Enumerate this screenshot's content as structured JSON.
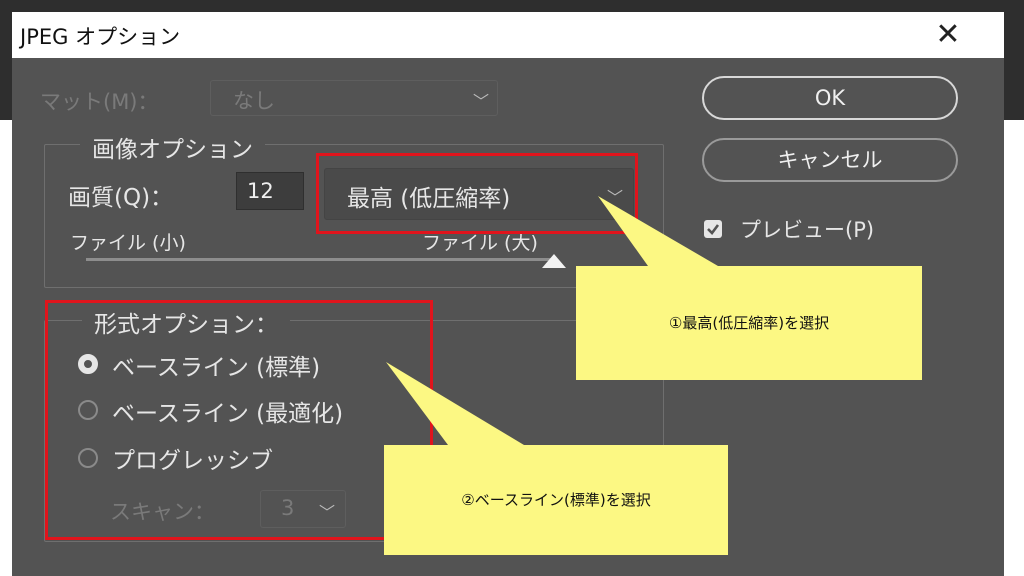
{
  "window": {
    "title": "JPEG オプション",
    "close_glyph": "✕"
  },
  "matte": {
    "label": "マット(M)：",
    "value": "なし"
  },
  "image_options": {
    "legend": "画像オプション",
    "quality_label": "画質(Q)：",
    "quality_value": "12",
    "quality_select": "最高 (低圧縮率)",
    "slider_min_label": "ファイル (小)",
    "slider_max_label": "ファイル (大)",
    "slider_position": 1.0
  },
  "format_options": {
    "legend": "形式オプション：",
    "radios": [
      {
        "label": "ベースライン (標準)",
        "checked": true
      },
      {
        "label": "ベースライン (最適化)",
        "checked": false
      },
      {
        "label": "プログレッシブ",
        "checked": false
      }
    ],
    "scan_label": "スキャン：",
    "scan_value": "3"
  },
  "buttons": {
    "ok": "OK",
    "cancel": "キャンセル"
  },
  "preview": {
    "label": "プレビュー(P)",
    "checked": true
  },
  "callouts": {
    "one": "①最高(低圧縮率)を選択",
    "two": "②ベースライン(標準)を選択"
  },
  "colors": {
    "dialog_bg": "#535353",
    "highlight_red": "#e0141c",
    "callout_yellow": "#fcf883"
  }
}
